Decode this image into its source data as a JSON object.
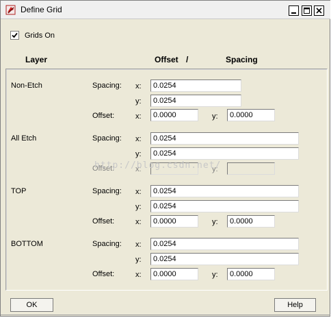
{
  "window": {
    "title": "Define Grid",
    "controls": [
      "minimize-icon",
      "maximize-icon",
      "close-icon"
    ]
  },
  "grids_on": {
    "label": "Grids On",
    "checked": true
  },
  "headers": {
    "layer": "Layer",
    "offset": "Offset",
    "slash": "/",
    "spacing": "Spacing"
  },
  "field_labels": {
    "spacing": "Spacing:",
    "offset": "Offset:",
    "x": "x:",
    "y": "y:"
  },
  "layers": [
    {
      "name": "Non-Etch",
      "spacing_x": "0.0254",
      "spacing_y": "0.0254",
      "offset_x": "0.0000",
      "offset_y": "0.0000"
    },
    {
      "name": "All Etch",
      "spacing_x": "0.0254",
      "spacing_y": "0.0254",
      "offset_x": "",
      "offset_y": ""
    },
    {
      "name": "TOP",
      "spacing_x": "0.0254",
      "spacing_y": "0.0254",
      "offset_x": "0.0000",
      "offset_y": "0.0000"
    },
    {
      "name": "BOTTOM",
      "spacing_x": "0.0254",
      "spacing_y": "0.0254",
      "offset_x": "0.0000",
      "offset_y": "0.0000"
    }
  ],
  "watermark": "http://blog.csdn.net/",
  "buttons": {
    "ok": "OK",
    "help": "Help"
  }
}
